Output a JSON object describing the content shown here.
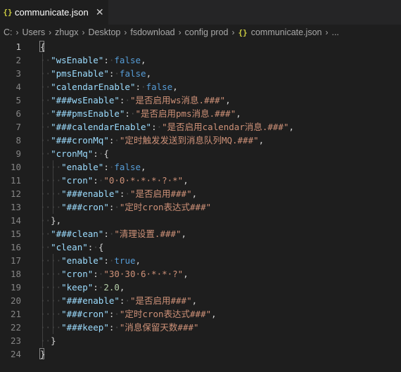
{
  "tab": {
    "icon": "{}",
    "label": "communicate.json",
    "close": "✕"
  },
  "breadcrumb": {
    "segments": [
      "C:",
      "Users",
      "zhugx",
      "Desktop",
      "fsdownload",
      "config prod"
    ],
    "file_icon": "{}",
    "file": "communicate.json",
    "more": "..."
  },
  "editor": {
    "lines": [
      {
        "n": "1",
        "tokens": [
          [
            "p",
            "{"
          ]
        ]
      },
      {
        "n": "2",
        "tokens": [
          [
            "w",
            "··"
          ],
          [
            "k",
            "\"wsEnable\""
          ],
          [
            "p",
            ":"
          ],
          [
            "w",
            "·"
          ],
          [
            "b",
            "false"
          ],
          [
            "p",
            ","
          ]
        ]
      },
      {
        "n": "3",
        "tokens": [
          [
            "w",
            "··"
          ],
          [
            "k",
            "\"pmsEnable\""
          ],
          [
            "p",
            ":"
          ],
          [
            "w",
            "·"
          ],
          [
            "b",
            "false"
          ],
          [
            "p",
            ","
          ]
        ]
      },
      {
        "n": "4",
        "tokens": [
          [
            "w",
            "··"
          ],
          [
            "k",
            "\"calendarEnable\""
          ],
          [
            "p",
            ":"
          ],
          [
            "w",
            "·"
          ],
          [
            "b",
            "false"
          ],
          [
            "p",
            ","
          ]
        ]
      },
      {
        "n": "5",
        "tokens": [
          [
            "w",
            "··"
          ],
          [
            "k",
            "\"###wsEnable\""
          ],
          [
            "p",
            ":"
          ],
          [
            "w",
            "·"
          ],
          [
            "s",
            "\"是否启用ws消息.###\""
          ],
          [
            "p",
            ","
          ]
        ]
      },
      {
        "n": "6",
        "tokens": [
          [
            "w",
            "··"
          ],
          [
            "k",
            "\"###pmsEnable\""
          ],
          [
            "p",
            ":"
          ],
          [
            "w",
            "·"
          ],
          [
            "s",
            "\"是否启用pms消息.###\""
          ],
          [
            "p",
            ","
          ]
        ]
      },
      {
        "n": "7",
        "tokens": [
          [
            "w",
            "··"
          ],
          [
            "k",
            "\"###calendarEnable\""
          ],
          [
            "p",
            ":"
          ],
          [
            "w",
            "·"
          ],
          [
            "s",
            "\"是否启用calendar消息.###\""
          ],
          [
            "p",
            ","
          ]
        ]
      },
      {
        "n": "8",
        "tokens": [
          [
            "w",
            "··"
          ],
          [
            "k",
            "\"###cronMq\""
          ],
          [
            "p",
            ":"
          ],
          [
            "w",
            "·"
          ],
          [
            "s",
            "\"定时触发发送到消息队列MQ.###\""
          ],
          [
            "p",
            ","
          ]
        ]
      },
      {
        "n": "9",
        "tokens": [
          [
            "w",
            "··"
          ],
          [
            "k",
            "\"cronMq\""
          ],
          [
            "p",
            ":"
          ],
          [
            "w",
            "·"
          ],
          [
            "p",
            "{"
          ]
        ]
      },
      {
        "n": "10",
        "tokens": [
          [
            "w",
            "····"
          ],
          [
            "k",
            "\"enable\""
          ],
          [
            "p",
            ":"
          ],
          [
            "w",
            "·"
          ],
          [
            "b",
            "false"
          ],
          [
            "p",
            ","
          ]
        ]
      },
      {
        "n": "11",
        "tokens": [
          [
            "w",
            "····"
          ],
          [
            "k",
            "\"cron\""
          ],
          [
            "p",
            ":"
          ],
          [
            "w",
            "·"
          ],
          [
            "s",
            "\"0·0·*·*·*·?·*\""
          ],
          [
            "p",
            ","
          ]
        ]
      },
      {
        "n": "12",
        "tokens": [
          [
            "w",
            "····"
          ],
          [
            "k",
            "\"###enable\""
          ],
          [
            "p",
            ":"
          ],
          [
            "w",
            "·"
          ],
          [
            "s",
            "\"是否启用###\""
          ],
          [
            "p",
            ","
          ]
        ]
      },
      {
        "n": "13",
        "tokens": [
          [
            "w",
            "····"
          ],
          [
            "k",
            "\"###cron\""
          ],
          [
            "p",
            ":"
          ],
          [
            "w",
            "·"
          ],
          [
            "s",
            "\"定时cron表达式###\""
          ]
        ]
      },
      {
        "n": "14",
        "tokens": [
          [
            "w",
            "··"
          ],
          [
            "p",
            "},"
          ]
        ]
      },
      {
        "n": "15",
        "tokens": [
          [
            "w",
            "··"
          ],
          [
            "k",
            "\"###clean\""
          ],
          [
            "p",
            ":"
          ],
          [
            "w",
            "·"
          ],
          [
            "s",
            "\"清理设置.###\""
          ],
          [
            "p",
            ","
          ]
        ]
      },
      {
        "n": "16",
        "tokens": [
          [
            "w",
            "··"
          ],
          [
            "k",
            "\"clean\""
          ],
          [
            "p",
            ":"
          ],
          [
            "w",
            "·"
          ],
          [
            "p",
            "{"
          ]
        ]
      },
      {
        "n": "17",
        "tokens": [
          [
            "w",
            "····"
          ],
          [
            "k",
            "\"enable\""
          ],
          [
            "p",
            ":"
          ],
          [
            "w",
            "·"
          ],
          [
            "b",
            "true"
          ],
          [
            "p",
            ","
          ]
        ]
      },
      {
        "n": "18",
        "tokens": [
          [
            "w",
            "····"
          ],
          [
            "k",
            "\"cron\""
          ],
          [
            "p",
            ":"
          ],
          [
            "w",
            "·"
          ],
          [
            "s",
            "\"30·30·6·*·*·?\""
          ],
          [
            "p",
            ","
          ]
        ]
      },
      {
        "n": "19",
        "tokens": [
          [
            "w",
            "····"
          ],
          [
            "k",
            "\"keep\""
          ],
          [
            "p",
            ":"
          ],
          [
            "w",
            "·"
          ],
          [
            "n",
            "2.0"
          ],
          [
            "p",
            ","
          ]
        ]
      },
      {
        "n": "20",
        "tokens": [
          [
            "w",
            "····"
          ],
          [
            "k",
            "\"###enable\""
          ],
          [
            "p",
            ":"
          ],
          [
            "w",
            "·"
          ],
          [
            "s",
            "\"是否启用###\""
          ],
          [
            "p",
            ","
          ]
        ]
      },
      {
        "n": "21",
        "tokens": [
          [
            "w",
            "····"
          ],
          [
            "k",
            "\"###cron\""
          ],
          [
            "p",
            ":"
          ],
          [
            "w",
            "·"
          ],
          [
            "s",
            "\"定时cron表达式###\""
          ],
          [
            "p",
            ","
          ]
        ]
      },
      {
        "n": "22",
        "tokens": [
          [
            "w",
            "····"
          ],
          [
            "k",
            "\"###keep\""
          ],
          [
            "p",
            ":"
          ],
          [
            "w",
            "·"
          ],
          [
            "s",
            "\"消息保留天数###\""
          ]
        ]
      },
      {
        "n": "23",
        "tokens": [
          [
            "w",
            "··"
          ],
          [
            "p",
            "}"
          ]
        ]
      },
      {
        "n": "24",
        "tokens": [
          [
            "p",
            "}"
          ]
        ]
      }
    ],
    "current_line": "1",
    "colors": {
      "background": "#1e1e1e",
      "key": "#9cdcfe",
      "string": "#ce9178",
      "boolean": "#569cd6",
      "number": "#b5cea8",
      "punctuation": "#d4d4d4",
      "line_number": "#858585"
    }
  }
}
